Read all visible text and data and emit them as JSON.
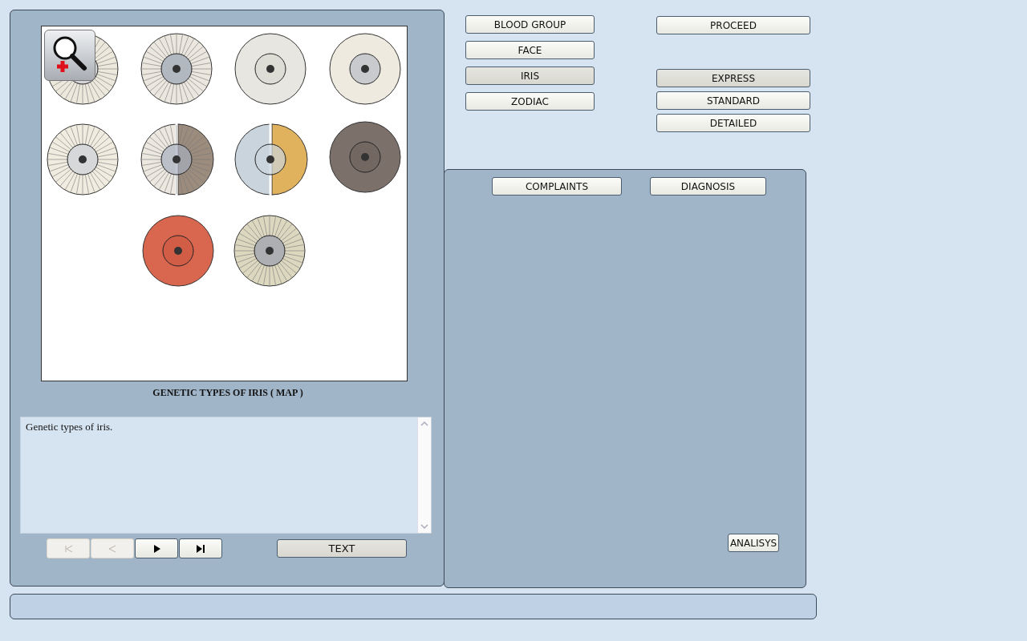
{
  "image_panel": {
    "caption": "GENETIC TYPES OF IRIS ( MAP )",
    "description": "Genetic types of iris.",
    "nav_buttons": [
      {
        "kind": "first",
        "disabled": true
      },
      {
        "kind": "prev",
        "disabled": true
      },
      {
        "kind": "next",
        "disabled": false
      },
      {
        "kind": "last",
        "disabled": false
      }
    ],
    "text_button": {
      "label": "TEXT",
      "selected": true
    }
  },
  "sections": [
    {
      "label": "BLOOD GROUP",
      "selected": false
    },
    {
      "label": "FACE",
      "selected": false
    },
    {
      "label": "IRIS",
      "selected": true
    },
    {
      "label": "ZODIAC",
      "selected": false
    }
  ],
  "proceed_button": "PROCEED",
  "modes": [
    {
      "label": "EXPRESS",
      "selected": true
    },
    {
      "label": "STANDARD",
      "selected": false
    },
    {
      "label": "DETAILED",
      "selected": false
    }
  ],
  "analysis_panel": {
    "buttons": [
      "COMPLAINTS",
      "DIAGNOSIS"
    ],
    "analysis_button": "ANALISYS"
  }
}
